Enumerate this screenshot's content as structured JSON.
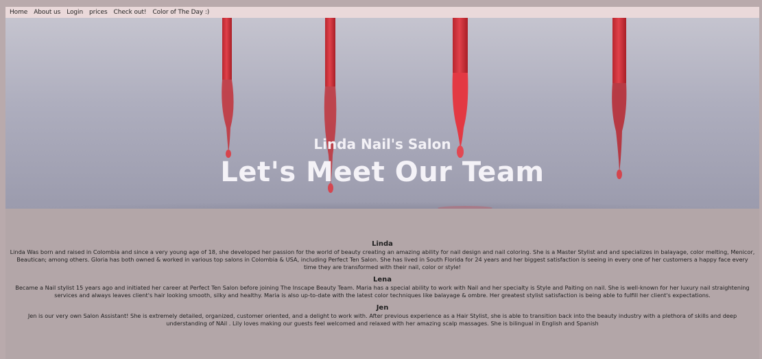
{
  "nav": {
    "items": [
      {
        "label": "Home"
      },
      {
        "label": "About us"
      },
      {
        "label": "Login"
      },
      {
        "label": "prices"
      },
      {
        "label": "Check out!"
      },
      {
        "label": "Color of The Day :)"
      }
    ]
  },
  "hero": {
    "subtitle": "Linda Nail's Salon",
    "title": "Let's Meet Our Team"
  },
  "team": [
    {
      "name": "Linda",
      "bio": "Linda Was born and raised in Colombia and since a very young age of 18, she developed her passion for the world of beauty creating an amazing ability for nail design and nail coloring. She is a Master Stylist and and specializes in balayage, color melting, Menicor, Beautican; among others. Gloria has both owned & worked in various top salons in Colombia & USA, including Perfect Ten Salon. She has lived in South Florida for 24 years and her biggest satisfaction is seeing in every one of her customers a happy face every time they are transformed with their nail, color or style!"
    },
    {
      "name": "Lena",
      "bio": "Became a Nail stylist 15 years ago and initiated her career at Perfect Ten Salon before joining The Inscape Beauty Team. Maria has a special ability to work with Nail and her specialty is Style and Paiting on nail. She is well-known for her luxury nail straightening services and always leaves client's hair looking smooth, silky and healthy. Maria is also up-to-date with the latest color techniques like balayage & ombre. Her greatest stylist satisfaction is being able to fulfill her client's expectations."
    },
    {
      "name": "Jen",
      "bio": "Jen is our very own Salon Assistant! She is extremely detailed, organized, customer oriented, and a delight to work with. After previous experience as a Hair Stylist, she is able to transition back into the beauty industry with a plethora of skills and deep understanding of NAil . Lily loves making our guests feel welcomed and relaxed with her amazing scalp massages. She is bilingual in English and Spanish"
    }
  ],
  "colors": {
    "nav_bg": "#ead9da",
    "page_bg": "#b3a6a8",
    "polish_red": "#d8323b"
  }
}
